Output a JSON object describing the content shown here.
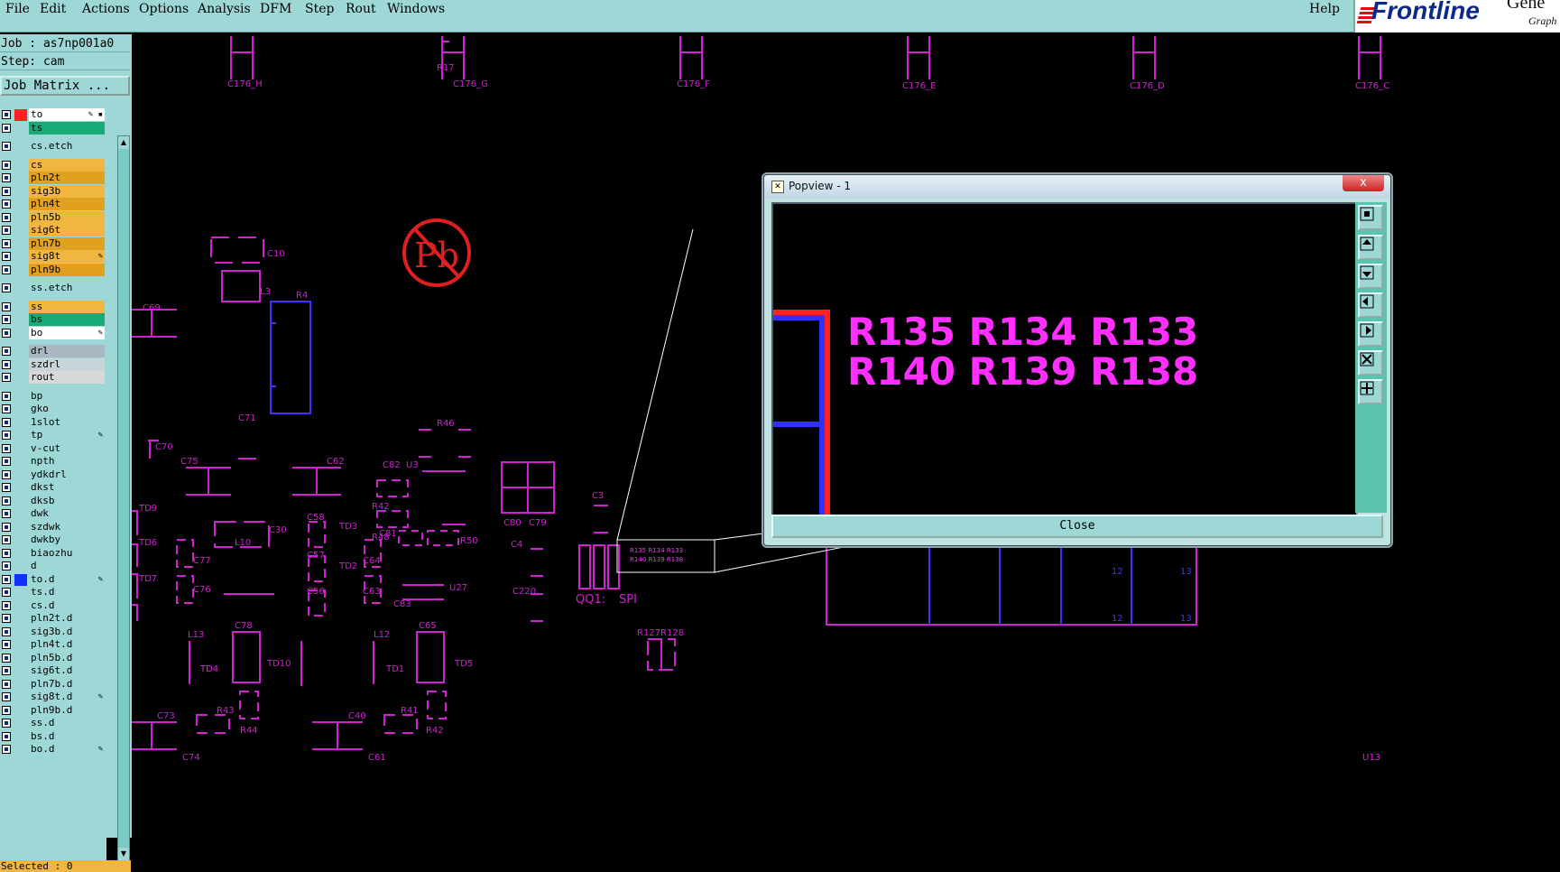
{
  "menubar": {
    "items": [
      "File",
      "Edit",
      "Actions",
      "Options",
      "Analysis",
      "DFM",
      "Step",
      "Rout",
      "Windows"
    ],
    "help": "Help",
    "logo": {
      "brand": "Frontline",
      "suffix": "Gene",
      "sub": "Graph"
    }
  },
  "left_panel": {
    "job": "Job : as7np001a0",
    "step": "Step: cam",
    "job_matrix": "Job Matrix ...",
    "selected": "Selected : 0",
    "layers": [
      {
        "name": "to",
        "color": "#ffffff",
        "swatch": "#ff2020",
        "mark": "✎ ▪"
      },
      {
        "name": "ts",
        "color": "#1aaa78",
        "swatch": "",
        "mark": ""
      },
      {
        "name": "cs.etch",
        "color": "#9ed8d6",
        "swatch": "",
        "mark": ""
      },
      {
        "name": "cs",
        "color": "#f0b640",
        "swatch": "",
        "mark": ""
      },
      {
        "name": "pln2t",
        "color": "#e0a020",
        "swatch": "",
        "mark": ""
      },
      {
        "name": "sig3b",
        "color": "#f0b640",
        "swatch": "",
        "mark": ""
      },
      {
        "name": "pln4t",
        "color": "#e0a020",
        "swatch": "",
        "mark": ""
      },
      {
        "name": "pln5b",
        "color": "#f0b640",
        "swatch": "",
        "mark": ""
      },
      {
        "name": "sig6t",
        "color": "#f0b640",
        "swatch": "",
        "mark": ""
      },
      {
        "name": "pln7b",
        "color": "#e0a020",
        "swatch": "",
        "mark": ""
      },
      {
        "name": "sig8t",
        "color": "#f0b640",
        "swatch": "",
        "mark": "✎"
      },
      {
        "name": "pln9b",
        "color": "#e0a020",
        "swatch": "",
        "mark": ""
      },
      {
        "name": "ss.etch",
        "color": "#9ed8d6",
        "swatch": "",
        "mark": ""
      },
      {
        "name": "ss",
        "color": "#f0b640",
        "swatch": "",
        "mark": ""
      },
      {
        "name": "bs",
        "color": "#1aaa78",
        "swatch": "",
        "mark": ""
      },
      {
        "name": "bo",
        "color": "#ffffff",
        "swatch": "",
        "mark": "✎"
      },
      {
        "name": "drl",
        "color": "#a8b8c0",
        "swatch": "",
        "mark": ""
      },
      {
        "name": "szdrl",
        "color": "#c8d4d8",
        "swatch": "",
        "mark": ""
      },
      {
        "name": "rout",
        "color": "#d8d8d8",
        "swatch": "",
        "mark": ""
      },
      {
        "name": "bp",
        "color": "#9ed8d6",
        "swatch": "",
        "mark": ""
      },
      {
        "name": "gko",
        "color": "#9ed8d6",
        "swatch": "",
        "mark": ""
      },
      {
        "name": "1slot",
        "color": "#9ed8d6",
        "swatch": "",
        "mark": ""
      },
      {
        "name": "tp",
        "color": "#9ed8d6",
        "swatch": "",
        "mark": "✎"
      },
      {
        "name": "v-cut",
        "color": "#9ed8d6",
        "swatch": "",
        "mark": ""
      },
      {
        "name": "npth",
        "color": "#9ed8d6",
        "swatch": "",
        "mark": ""
      },
      {
        "name": "ydkdrl",
        "color": "#9ed8d6",
        "swatch": "",
        "mark": ""
      },
      {
        "name": "dkst",
        "color": "#9ed8d6",
        "swatch": "",
        "mark": ""
      },
      {
        "name": "dksb",
        "color": "#9ed8d6",
        "swatch": "",
        "mark": ""
      },
      {
        "name": "dwk",
        "color": "#9ed8d6",
        "swatch": "",
        "mark": ""
      },
      {
        "name": "szdwk",
        "color": "#9ed8d6",
        "swatch": "",
        "mark": ""
      },
      {
        "name": "dwkby",
        "color": "#9ed8d6",
        "swatch": "",
        "mark": ""
      },
      {
        "name": "biaozhu",
        "color": "#9ed8d6",
        "swatch": "",
        "mark": ""
      },
      {
        "name": "d",
        "color": "#9ed8d6",
        "swatch": "",
        "mark": ""
      },
      {
        "name": "to.d",
        "color": "#9ed8d6",
        "swatch": "#1030ff",
        "mark": "✎"
      },
      {
        "name": "ts.d",
        "color": "#9ed8d6",
        "swatch": "",
        "mark": ""
      },
      {
        "name": "cs.d",
        "color": "#9ed8d6",
        "swatch": "",
        "mark": ""
      },
      {
        "name": "pln2t.d",
        "color": "#9ed8d6",
        "swatch": "",
        "mark": ""
      },
      {
        "name": "sig3b.d",
        "color": "#9ed8d6",
        "swatch": "",
        "mark": ""
      },
      {
        "name": "pln4t.d",
        "color": "#9ed8d6",
        "swatch": "",
        "mark": ""
      },
      {
        "name": "pln5b.d",
        "color": "#9ed8d6",
        "swatch": "",
        "mark": ""
      },
      {
        "name": "sig6t.d",
        "color": "#9ed8d6",
        "swatch": "",
        "mark": ""
      },
      {
        "name": "pln7b.d",
        "color": "#9ed8d6",
        "swatch": "",
        "mark": ""
      },
      {
        "name": "sig8t.d",
        "color": "#9ed8d6",
        "swatch": "",
        "mark": "✎"
      },
      {
        "name": "pln9b.d",
        "color": "#9ed8d6",
        "swatch": "",
        "mark": ""
      },
      {
        "name": "ss.d",
        "color": "#9ed8d6",
        "swatch": "",
        "mark": ""
      },
      {
        "name": "bs.d",
        "color": "#9ed8d6",
        "swatch": "",
        "mark": ""
      },
      {
        "name": "bo.d",
        "color": "#9ed8d6",
        "swatch": "",
        "mark": "✎"
      }
    ]
  },
  "canvas": {
    "labels": [
      "C176_H",
      "R17",
      "C176_G",
      "C176_F",
      "C176_E",
      "C176_D",
      "C176_C",
      "C10",
      "L3",
      "R4",
      "C69",
      "C71",
      "C70",
      "C75",
      "C62",
      "R46",
      "C82",
      "U3",
      "R42",
      "R48",
      "C81",
      "R50",
      "C30",
      "L10",
      "C77",
      "C76",
      "TD9",
      "TD6",
      "TD7",
      "C58",
      "C57",
      "C56",
      "TD4",
      "TD3",
      "TD2",
      "C64",
      "C63",
      "C83",
      "U27",
      "C3",
      "C4",
      "C80",
      "C79",
      "C220",
      "QQ1:",
      "SPI",
      "R135 R134 R133",
      "R140 R139 R138",
      "R127R128",
      "L13",
      "C78",
      "TD10",
      "TD4",
      "L12",
      "C65",
      "TD1",
      "TD5",
      "R43",
      "R44",
      "C40",
      "R41",
      "R42",
      "C73",
      "C74",
      "C61",
      "12",
      "13",
      "12",
      "13",
      "U13"
    ],
    "pb_logo": "Pb"
  },
  "popview": {
    "title": "Popview - 1",
    "close_x": "x",
    "close_button": "Close",
    "view_text_row1": "R135 R134 R133",
    "view_text_row2": "R140 R139 R138"
  },
  "colors": {
    "panel": "#9ed8d6",
    "silkscreen": "#d020d0",
    "component_blue": "#4a2cff",
    "highlight_magenta": "#ff30ff"
  }
}
